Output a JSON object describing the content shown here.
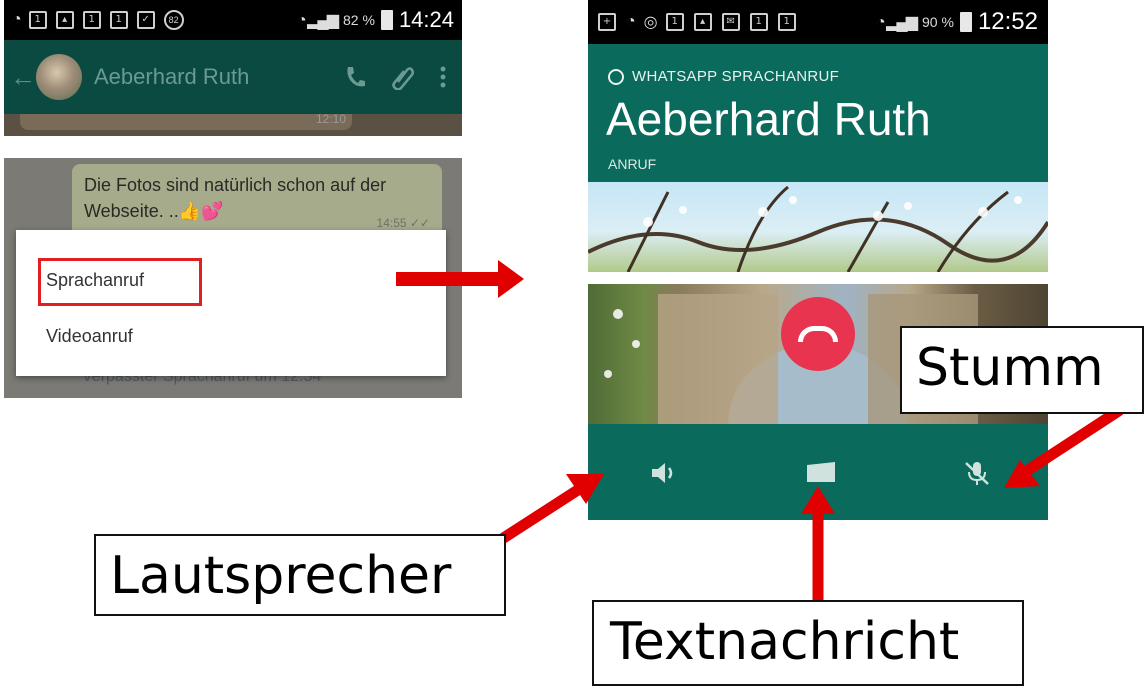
{
  "chat_header": {
    "status_time": "14:24",
    "status_battery": "82 %",
    "status_badge": "82",
    "contact_name": "Aeberhard Ruth",
    "timestamp_partial": "12:10"
  },
  "call_menu": {
    "message_text": "Die Fotos sind natürlich schon auf der Webseite. ..👍💕",
    "message_time": "14:55 ✓✓",
    "options": [
      "Sprachanruf",
      "Videoanruf"
    ],
    "missed_call_text": "Verpasster Sprachanruf um 12:54"
  },
  "call_screen": {
    "status_time": "12:52",
    "status_battery": "90 %",
    "call_type_label": "WHATSAPP SPRACHANRUF",
    "contact_name": "Aeberhard Ruth",
    "call_status": "ANRUF"
  },
  "annotations": {
    "mute": "Stumm",
    "speaker": "Lautsprecher",
    "text_message": "Textnachricht"
  },
  "colors": {
    "whatsapp_green": "#0a6a5c",
    "hangup_red": "#e8344e",
    "highlight_red": "#e02020",
    "arrow_red": "#e00000"
  }
}
